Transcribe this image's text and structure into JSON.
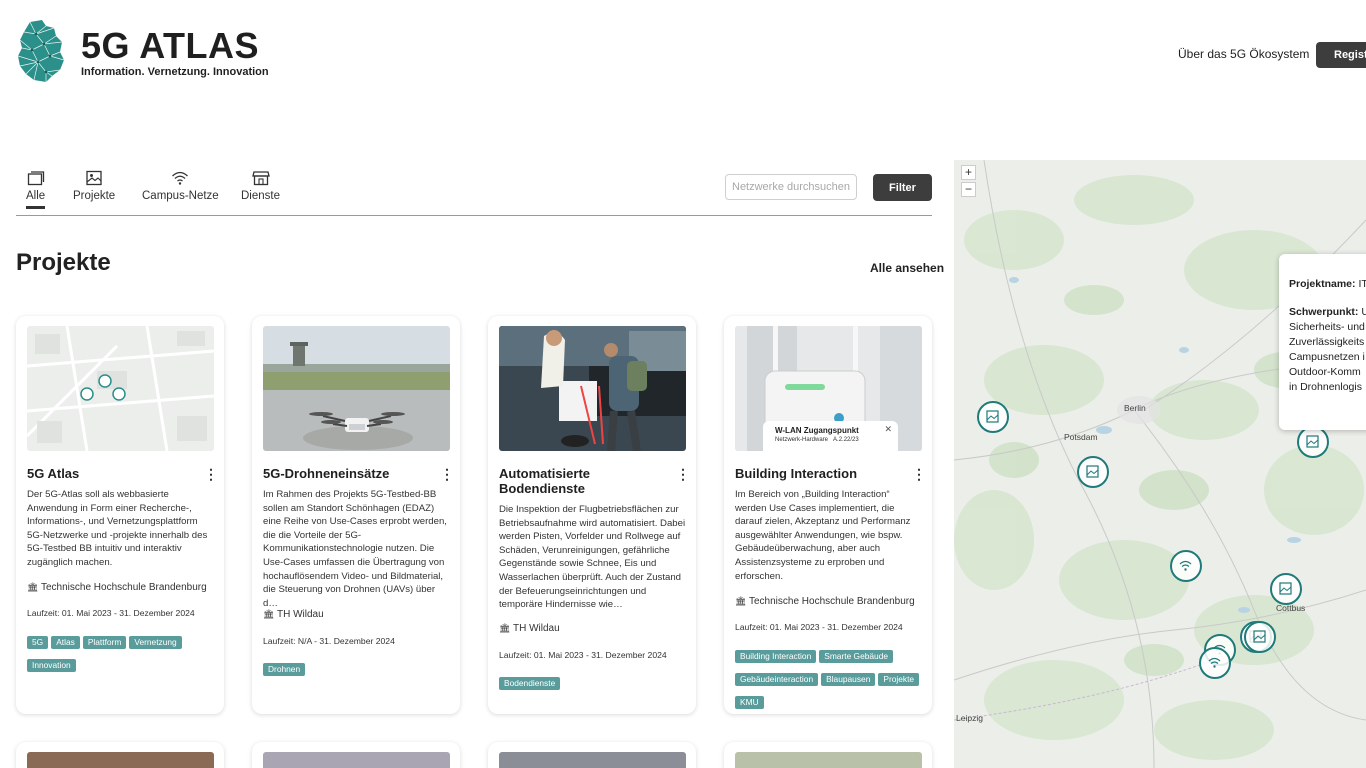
{
  "header": {
    "brand_title": "5G ATLAS",
    "brand_subtitle": "Information. Vernetzung. Innovation",
    "nav_link": "Über das 5G Ökosystem",
    "register_label": "Registrieren"
  },
  "tabs": [
    {
      "label": "Alle",
      "icon": "stack-icon",
      "active": true
    },
    {
      "label": "Projekte",
      "icon": "image-icon",
      "active": false
    },
    {
      "label": "Campus-Netze",
      "icon": "wifi-icon",
      "active": false
    },
    {
      "label": "Dienste",
      "icon": "store-icon",
      "active": false
    }
  ],
  "search": {
    "placeholder": "Netzwerke durchsuchen"
  },
  "filter_label": "Filter",
  "section": {
    "title": "Projekte",
    "see_all": "Alle ansehen"
  },
  "cards": [
    {
      "title": "5G Atlas",
      "description": "Der 5G-Atlas soll als webbasierte Anwendung in Form einer Recherche-, Informations-, und Vernetzungsplattform 5G-Netzwerke und -projekte innerhalb des 5G-Testbed BB intuitiv und interaktiv zugänglich machen.",
      "institution": "Technische Hochschule Brandenburg",
      "runtime": "Laufzeit: 01. Mai 2023 - 31. Dezember 2024",
      "tags": [
        "5G",
        "Atlas",
        "Plattform",
        "Vernetzung",
        "Innovation"
      ]
    },
    {
      "title": "5G-Drohneneinsätze",
      "description": "Im Rahmen des Projekts 5G-Testbed-BB sollen am Standort Schönhagen (EDAZ) eine Reihe von Use-Cases erprobt werden, die die Vorteile der 5G-Kommunikationstechnologie nutzen. Die Use-Cases umfassen die Übertragung von hochauflösendem Video- und Bildmaterial, die Steuerung von Drohnen (UAVs) über d…",
      "institution": "TH Wildau",
      "runtime": "Laufzeit: N/A - 31. Dezember 2024",
      "tags": [
        "Drohnen"
      ]
    },
    {
      "title": "Automatisierte Bodendienste",
      "description": "Die Inspektion der Flugbetriebsflächen zur Betriebsaufnahme wird automatisiert. Dabei werden Pisten, Vorfelder und Rollwege auf Schäden, Verunreinigungen, gefährliche Gegenstände sowie Schnee, Eis und Wasserlachen überprüft. Auch der Zustand der Befeuerungseinrichtungen und temporäre Hindernisse wie…",
      "institution": "TH Wildau",
      "runtime": "Laufzeit: 01. Mai 2023 - 31. Dezember 2024",
      "tags": [
        "Bodendienste"
      ]
    },
    {
      "title": "Building Interaction",
      "description": "Im Bereich von „Building Interaction“ werden Use Cases implementiert, die darauf zielen, Akzeptanz und Performanz ausgewählter Anwendungen, wie bspw. Gebäudeüberwachung, aber auch Assistenzsysteme zu erproben und erforschen.",
      "institution": "Technische Hochschule Brandenburg",
      "runtime": "Laufzeit: 01. Mai 2023 - 31. Dezember 2024",
      "tags": [
        "Building Interaction",
        "Smarte Gebäude",
        "Gebäudeinteraction",
        "Blaupausen",
        "Projekte",
        "KMU"
      ],
      "image_overlay": {
        "title": "W-LAN Zugangspunkt",
        "subtitle": "Netzwerk-Hardware",
        "code": "A.2.22/23"
      }
    }
  ],
  "map": {
    "zoom_in": "+",
    "zoom_out": "−",
    "labels": {
      "berlin": "Berlin",
      "potsdam": "Potsdam",
      "leipzig": "Leipzig",
      "cottbus": "Cottbus"
    },
    "popup": {
      "name_label": "Projektname:",
      "name_value": "IT",
      "focus_label": "Schwerpunkt:",
      "focus_value": "U",
      "lines": [
        "Sicherheits- und",
        "Zuverlässigkeits",
        "Campusnetzen i",
        "Outdoor-Komm",
        "in Drohnenlogis"
      ]
    }
  }
}
